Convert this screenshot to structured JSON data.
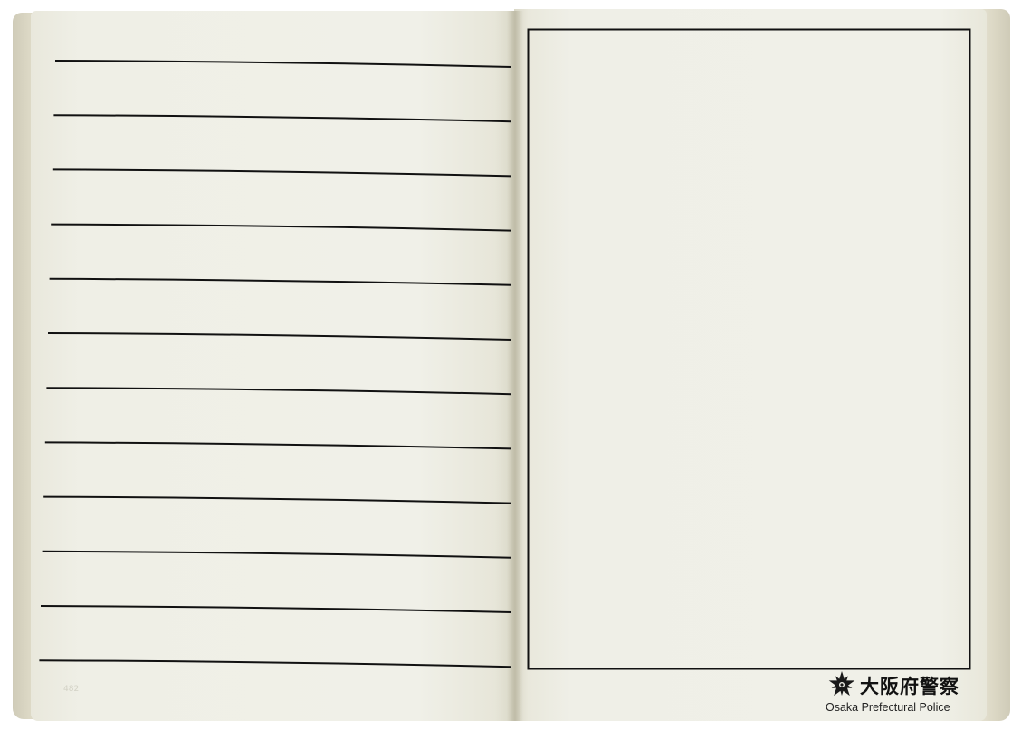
{
  "notebook": {
    "left_page": {
      "ruled_line_count": 12,
      "page_number": "482"
    },
    "right_page": {
      "frame": "empty box"
    }
  },
  "logo": {
    "name_jp": "大阪府警察",
    "name_en": "Osaka Prefectural Police",
    "emblem_icon": "police-emblem-icon"
  },
  "colors": {
    "paper": "#f0f0e8",
    "edge": "#dcd8c5",
    "ink": "#111111"
  }
}
